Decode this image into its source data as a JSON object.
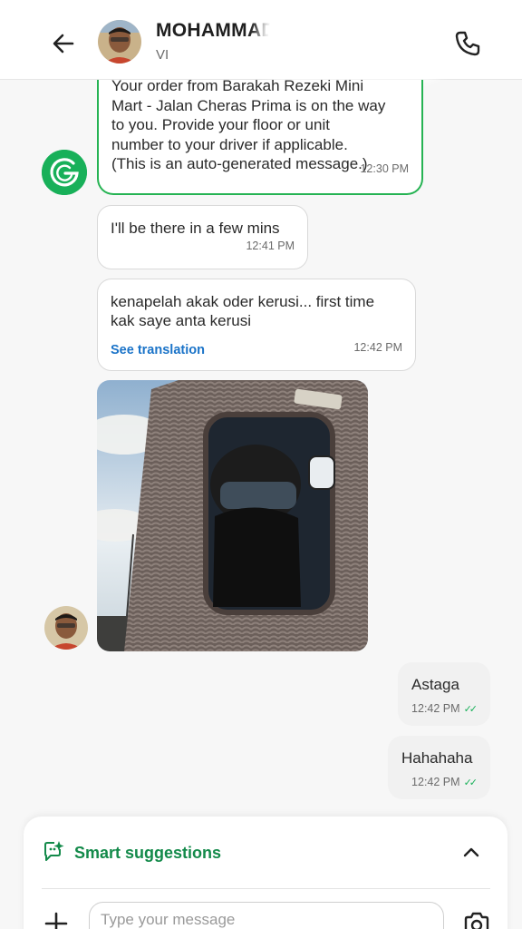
{
  "header": {
    "contact_name": "MOHAMMAD I",
    "contact_sub": "VI"
  },
  "messages": {
    "system": {
      "text_line1": "Your order from Barakah Rezeki Mini",
      "text_line2": "Mart - Jalan Cheras Prima is on the way",
      "text_line3": "to you. Provide your floor or unit",
      "text_line4": "number to your driver if applicable.",
      "text_line5": "(This is an auto-generated message.)",
      "time": "12:30 PM"
    },
    "incoming_1": {
      "text": "I'll be there in a few mins",
      "time": "12:41 PM"
    },
    "incoming_2": {
      "text_line1": "kenapelah akak oder kerusi... first time",
      "text_line2": "kak saye anta kerusi",
      "translation_link": "See translation",
      "time": "12:42 PM"
    },
    "outgoing_1": {
      "text": "Astaga",
      "time": "12:42 PM"
    },
    "outgoing_2": {
      "text": "Hahahaha",
      "time": "12:42 PM"
    }
  },
  "composer": {
    "smart_suggestions_label": "Smart suggestions",
    "placeholder": "Type your message"
  },
  "colors": {
    "brand_green": "#18b059",
    "link_blue": "#1a73c8",
    "system_border": "#26b353"
  }
}
